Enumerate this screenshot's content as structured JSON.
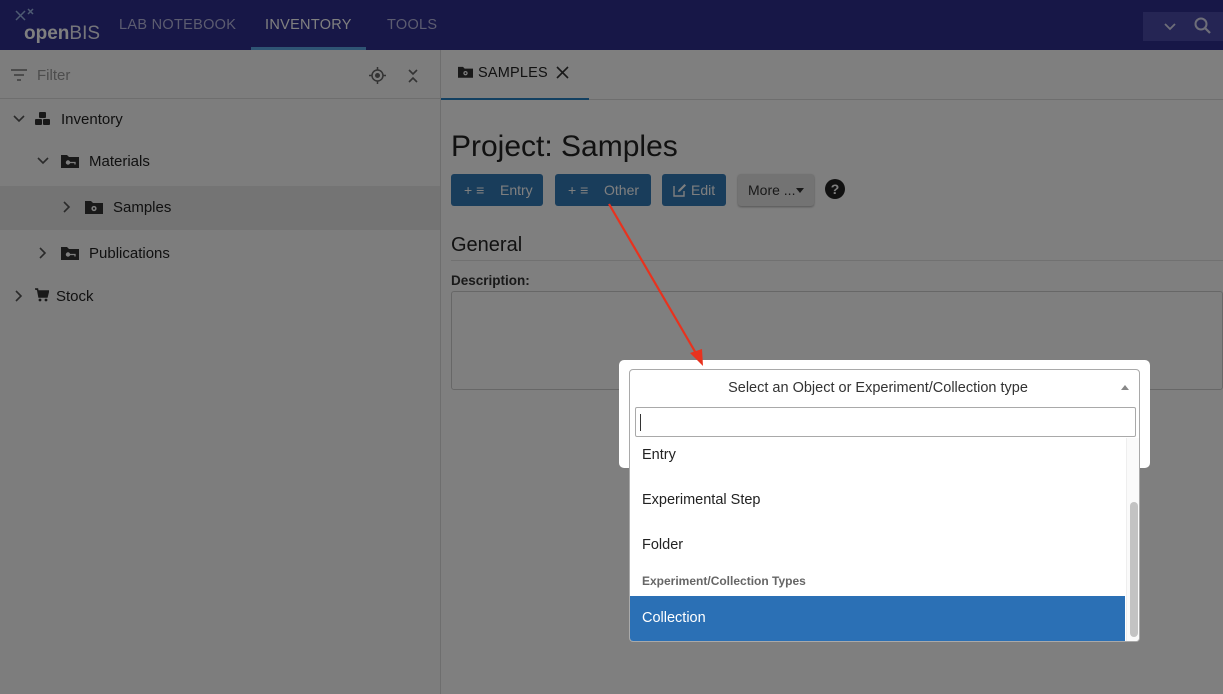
{
  "app": {
    "logo_text_bold": "open",
    "logo_text_rest": "BIS",
    "nav": [
      "LAB NOTEBOOK",
      "INVENTORY",
      "TOOLS"
    ],
    "active_nav": "INVENTORY"
  },
  "sidebar": {
    "filter_placeholder": "Filter",
    "tree": [
      {
        "label": "Inventory",
        "icon": "inventory-icon",
        "expanded": true,
        "level": 0
      },
      {
        "label": "Materials",
        "icon": "folder-key-icon",
        "expanded": true,
        "level": 1
      },
      {
        "label": "Samples",
        "icon": "folder-gear-icon",
        "expanded": false,
        "level": 2,
        "selected": true
      },
      {
        "label": "Publications",
        "icon": "folder-key-icon",
        "expanded": false,
        "level": 1
      },
      {
        "label": "Stock",
        "icon": "cart-icon",
        "expanded": false,
        "level": 0
      }
    ]
  },
  "tab": {
    "label": "SAMPLES",
    "icon": "folder-gear-icon"
  },
  "main": {
    "title": "Project: Samples",
    "buttons": {
      "entry": "Entry",
      "other": "Other",
      "edit": "Edit",
      "more": "More ..."
    },
    "section_title": "General",
    "description_label": "Description:"
  },
  "modal": {
    "select_placeholder": "Select an Object or Experiment/Collection type",
    "search_value": "",
    "items": [
      "Entry",
      "Experimental Step",
      "Folder"
    ],
    "group_label": "Experiment/Collection Types",
    "highlighted_item": "Collection"
  },
  "colors": {
    "topbar": "#2f2f8f",
    "primary_button": "#337ab7",
    "highlight": "#2b70b5",
    "annotation_arrow": "#e8321e"
  }
}
